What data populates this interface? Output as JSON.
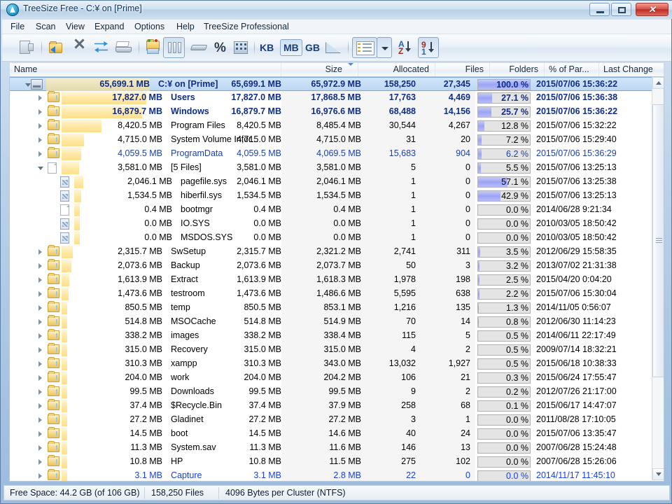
{
  "window": {
    "title": "TreeSize Free - C:¥  on  [Prime]",
    "icon": "treesize-app-icon",
    "minimize_label": "–",
    "maximize_label": "□",
    "close_label": "✕"
  },
  "menu": [
    {
      "label": "File",
      "accel": "F"
    },
    {
      "label": "Scan",
      "accel": "S"
    },
    {
      "label": "View",
      "accel": "V"
    },
    {
      "label": "Expand",
      "accel": "E"
    },
    {
      "label": "Options",
      "accel": "O"
    },
    {
      "label": "Help",
      "accel": "H"
    },
    {
      "label": "TreeSize Professional",
      "accel": ""
    }
  ],
  "toolbar": {
    "icons": [
      {
        "name": "open-drive-icon"
      },
      {
        "name": "open-folder-icon"
      },
      {
        "name": "close-icon"
      },
      {
        "name": "refresh-icon"
      },
      {
        "name": "print-icon"
      },
      {
        "name": "explorer-icon"
      },
      {
        "name": "columns-view-icon"
      },
      {
        "name": "allocated-space-icon"
      },
      {
        "name": "percent-icon"
      },
      {
        "name": "details-view-icon"
      },
      {
        "name": "chart-icon"
      },
      {
        "name": "list-view-icon"
      },
      {
        "name": "dropdown-icon"
      },
      {
        "name": "sort-az-icon"
      },
      {
        "name": "sort-91-icon"
      }
    ],
    "unit_kb": "KB",
    "unit_mb": "MB",
    "unit_gb": "GB",
    "unit_selected": "MB",
    "sort_az_label": "A\nZ",
    "sort_91_label": "9\n1"
  },
  "columns": [
    {
      "key": "name",
      "label": "Name",
      "align": "left"
    },
    {
      "key": "size",
      "label": "Size",
      "align": "right",
      "sorted": true,
      "sort_dir": "desc"
    },
    {
      "key": "allocated",
      "label": "Allocated",
      "align": "right"
    },
    {
      "key": "files",
      "label": "Files",
      "align": "right"
    },
    {
      "key": "folders",
      "label": "Folders",
      "align": "right"
    },
    {
      "key": "percent",
      "label": "% of Par...",
      "align": "right"
    },
    {
      "key": "last_change",
      "label": "Last Change",
      "align": "left"
    }
  ],
  "rows": [
    {
      "indent": 0,
      "icon": "drive",
      "twisty": "open",
      "name": "C:¥  on  [Prime]",
      "size": "65,699.1 MB",
      "bar": 100,
      "allocated": "65,972.9 MB",
      "files": "158,250",
      "folders": "27,345",
      "percent": "100.0 %",
      "pct": 100,
      "last_change": "2015/07/06 15:36:22",
      "style": "navy",
      "selected": true
    },
    {
      "indent": 1,
      "icon": "folder",
      "twisty": "closed",
      "name": "Users",
      "size": "17,827.0 MB",
      "bar": 27.1,
      "allocated": "17,868.5 MB",
      "files": "17,763",
      "folders": "4,469",
      "percent": "27.1 %",
      "pct": 27.1,
      "last_change": "2015/07/06 15:36:38",
      "style": "navy",
      "selected": false
    },
    {
      "indent": 1,
      "icon": "folder",
      "twisty": "closed",
      "name": "Windows",
      "size": "16,879.7 MB",
      "bar": 25.7,
      "allocated": "16,976.6 MB",
      "files": "68,488",
      "folders": "14,156",
      "percent": "25.7 %",
      "pct": 25.7,
      "last_change": "2015/07/06 15:36:22",
      "style": "navy",
      "selected": false
    },
    {
      "indent": 1,
      "icon": "folder",
      "twisty": "closed",
      "name": "Program Files",
      "size": "8,420.5 MB",
      "bar": 12.8,
      "allocated": "8,485.4 MB",
      "files": "30,544",
      "folders": "4,267",
      "percent": "12.8 %",
      "pct": 12.8,
      "last_change": "2015/07/06 15:32:22",
      "style": "black",
      "selected": false
    },
    {
      "indent": 1,
      "icon": "folder",
      "twisty": "closed",
      "name": "System Volume Infor...",
      "size": "4,715.0 MB",
      "bar": 7.2,
      "allocated": "4,715.0 MB",
      "files": "31",
      "folders": "20",
      "percent": "7.2 %",
      "pct": 7.2,
      "last_change": "2015/07/06 15:29:40",
      "style": "black",
      "selected": false
    },
    {
      "indent": 1,
      "icon": "folder",
      "twisty": "closed",
      "name": "ProgramData",
      "size": "4,059.5 MB",
      "bar": 6.2,
      "allocated": "4,069.5 MB",
      "files": "15,683",
      "folders": "904",
      "percent": "6.2 %",
      "pct": 6.2,
      "last_change": "2015/07/06 15:36:29",
      "style": "blue",
      "selected": false
    },
    {
      "indent": 1,
      "icon": "file",
      "twisty": "open",
      "name": "[5 Files]",
      "size": "3,581.0 MB",
      "bar": 5.5,
      "allocated": "3,581.0 MB",
      "files": "5",
      "folders": "0",
      "percent": "5.5 %",
      "pct": 5.5,
      "last_change": "2015/07/06 13:25:13",
      "style": "black",
      "selected": false
    },
    {
      "indent": 2,
      "icon": "sysfile",
      "twisty": "none",
      "name": "pagefile.sys",
      "size": "2,046.1 MB",
      "bar": 3.1,
      "allocated": "2,046.1 MB",
      "files": "1",
      "folders": "0",
      "percent": "57.1 %",
      "pct": 57.1,
      "last_change": "2015/07/06 13:25:38",
      "style": "black",
      "selected": false
    },
    {
      "indent": 2,
      "icon": "sysfile",
      "twisty": "none",
      "name": "hiberfil.sys",
      "size": "1,534.5 MB",
      "bar": 2.3,
      "allocated": "1,534.5 MB",
      "files": "1",
      "folders": "0",
      "percent": "42.9 %",
      "pct": 42.9,
      "last_change": "2015/07/06 13:25:13",
      "style": "black",
      "selected": false
    },
    {
      "indent": 2,
      "icon": "file",
      "twisty": "none",
      "name": "bootmgr",
      "size": "0.4 MB",
      "bar": 0,
      "allocated": "0.4 MB",
      "files": "1",
      "folders": "0",
      "percent": "0.0 %",
      "pct": 0,
      "last_change": "2014/06/28 9:21:34",
      "style": "black",
      "selected": false
    },
    {
      "indent": 2,
      "icon": "sysfile",
      "twisty": "none",
      "name": "IO.SYS",
      "size": "0.0 MB",
      "bar": 0,
      "allocated": "0.0 MB",
      "files": "1",
      "folders": "0",
      "percent": "0.0 %",
      "pct": 0,
      "last_change": "2010/03/05 18:50:42",
      "style": "black",
      "selected": false
    },
    {
      "indent": 2,
      "icon": "sysfile",
      "twisty": "none",
      "name": "MSDOS.SYS",
      "size": "0.0 MB",
      "bar": 0,
      "allocated": "0.0 MB",
      "files": "1",
      "folders": "0",
      "percent": "0.0 %",
      "pct": 0,
      "last_change": "2010/03/05 18:50:42",
      "style": "black",
      "selected": false
    },
    {
      "indent": 1,
      "icon": "folder",
      "twisty": "closed",
      "name": "SwSetup",
      "size": "2,315.7 MB",
      "bar": 3.5,
      "allocated": "2,321.2 MB",
      "files": "2,741",
      "folders": "311",
      "percent": "3.5 %",
      "pct": 3.5,
      "last_change": "2012/06/29 15:58:35",
      "style": "black",
      "selected": false
    },
    {
      "indent": 1,
      "icon": "folder",
      "twisty": "closed",
      "name": "Backup",
      "size": "2,073.6 MB",
      "bar": 3.2,
      "allocated": "2,073.7 MB",
      "files": "50",
      "folders": "3",
      "percent": "3.2 %",
      "pct": 3.2,
      "last_change": "2013/07/02 21:31:38",
      "style": "black",
      "selected": false
    },
    {
      "indent": 1,
      "icon": "folder",
      "twisty": "closed",
      "name": "Extract",
      "size": "1,613.9 MB",
      "bar": 2.5,
      "allocated": "1,618.3 MB",
      "files": "1,978",
      "folders": "198",
      "percent": "2.5 %",
      "pct": 2.5,
      "last_change": "2015/04/20 0:04:20",
      "style": "black",
      "selected": false
    },
    {
      "indent": 1,
      "icon": "folder",
      "twisty": "closed",
      "name": "testroom",
      "size": "1,473.6 MB",
      "bar": 2.2,
      "allocated": "1,486.6 MB",
      "files": "5,595",
      "folders": "638",
      "percent": "2.2 %",
      "pct": 2.2,
      "last_change": "2015/07/06 15:30:04",
      "style": "black",
      "selected": false
    },
    {
      "indent": 1,
      "icon": "folder",
      "twisty": "closed",
      "name": "temp",
      "size": "850.5 MB",
      "bar": 1.3,
      "allocated": "853.1 MB",
      "files": "1,216",
      "folders": "135",
      "percent": "1.3 %",
      "pct": 1.3,
      "last_change": "2014/11/05 0:56:07",
      "style": "black",
      "selected": false
    },
    {
      "indent": 1,
      "icon": "folder",
      "twisty": "closed",
      "name": "MSOCache",
      "size": "514.8 MB",
      "bar": 0.8,
      "allocated": "514.9 MB",
      "files": "70",
      "folders": "14",
      "percent": "0.8 %",
      "pct": 0.8,
      "last_change": "2012/06/30 11:14:23",
      "style": "black",
      "selected": false
    },
    {
      "indent": 1,
      "icon": "folder",
      "twisty": "closed",
      "name": "images",
      "size": "338.2 MB",
      "bar": 0.5,
      "allocated": "338.4 MB",
      "files": "115",
      "folders": "5",
      "percent": "0.5 %",
      "pct": 0.5,
      "last_change": "2014/06/11 22:17:49",
      "style": "black",
      "selected": false
    },
    {
      "indent": 1,
      "icon": "folder",
      "twisty": "closed",
      "name": "Recovery",
      "size": "315.0 MB",
      "bar": 0.5,
      "allocated": "315.0 MB",
      "files": "4",
      "folders": "2",
      "percent": "0.5 %",
      "pct": 0.5,
      "last_change": "2009/07/14 18:32:21",
      "style": "black",
      "selected": false
    },
    {
      "indent": 1,
      "icon": "folder",
      "twisty": "closed",
      "name": "xampp",
      "size": "310.3 MB",
      "bar": 0.5,
      "allocated": "343.0 MB",
      "files": "13,032",
      "folders": "1,927",
      "percent": "0.5 %",
      "pct": 0.5,
      "last_change": "2015/06/18 10:38:33",
      "style": "black",
      "selected": false
    },
    {
      "indent": 1,
      "icon": "folder",
      "twisty": "closed",
      "name": "work",
      "size": "204.0 MB",
      "bar": 0.3,
      "allocated": "204.2 MB",
      "files": "106",
      "folders": "21",
      "percent": "0.3 %",
      "pct": 0.3,
      "last_change": "2015/06/24 17:55:47",
      "style": "black",
      "selected": false
    },
    {
      "indent": 1,
      "icon": "folder",
      "twisty": "closed",
      "name": "Downloads",
      "size": "99.5 MB",
      "bar": 0.2,
      "allocated": "99.5 MB",
      "files": "9",
      "folders": "2",
      "percent": "0.2 %",
      "pct": 0.2,
      "last_change": "2012/07/26 21:17:00",
      "style": "black",
      "selected": false
    },
    {
      "indent": 1,
      "icon": "folder",
      "twisty": "closed",
      "name": "$Recycle.Bin",
      "size": "37.4 MB",
      "bar": 0.1,
      "allocated": "37.9 MB",
      "files": "258",
      "folders": "68",
      "percent": "0.1 %",
      "pct": 0.1,
      "last_change": "2015/06/17 14:47:07",
      "style": "black",
      "selected": false
    },
    {
      "indent": 1,
      "icon": "folder",
      "twisty": "closed",
      "name": "Gladinet",
      "size": "27.2 MB",
      "bar": 0.05,
      "allocated": "27.2 MB",
      "files": "3",
      "folders": "1",
      "percent": "0.0 %",
      "pct": 0,
      "last_change": "2011/08/28 17:10:05",
      "style": "black",
      "selected": false
    },
    {
      "indent": 1,
      "icon": "folder",
      "twisty": "closed",
      "name": "boot",
      "size": "14.5 MB",
      "bar": 0.03,
      "allocated": "14.6 MB",
      "files": "40",
      "folders": "24",
      "percent": "0.0 %",
      "pct": 0,
      "last_change": "2015/07/06 13:35:47",
      "style": "black",
      "selected": false
    },
    {
      "indent": 1,
      "icon": "folder",
      "twisty": "closed",
      "name": "System.sav",
      "size": "11.3 MB",
      "bar": 0.02,
      "allocated": "11.6 MB",
      "files": "146",
      "folders": "13",
      "percent": "0.0 %",
      "pct": 0,
      "last_change": "2007/06/28 15:24:48",
      "style": "black",
      "selected": false
    },
    {
      "indent": 1,
      "icon": "folder",
      "twisty": "closed",
      "name": "HP",
      "size": "10.8 MB",
      "bar": 0.02,
      "allocated": "11.5 MB",
      "files": "275",
      "folders": "102",
      "percent": "0.0 %",
      "pct": 0,
      "last_change": "2007/06/28 15:26:06",
      "style": "black",
      "selected": false
    },
    {
      "indent": 1,
      "icon": "folder",
      "twisty": "closed",
      "name": "Capture",
      "size": "3.1 MB",
      "bar": 0.01,
      "allocated": "2.8 MB",
      "files": "22",
      "folders": "0",
      "percent": "0.0 %",
      "pct": 0,
      "last_change": "2014/11/17 11:45:10",
      "style": "link",
      "selected": false
    }
  ],
  "statusbar": {
    "free_space": "Free Space: 44.2 GB  (of 106 GB)",
    "files": "158,250  Files",
    "cluster": "4096 Bytes per Cluster (NTFS)"
  },
  "scrollbar": {
    "up_icon": "scroll-up-arrow-icon",
    "down_icon": "scroll-down-arrow-icon",
    "thumb_top_pct": 4,
    "thumb_height_pct": 72
  },
  "colors": {
    "navy": "#0f2d86",
    "blue": "#1d3fa8",
    "link": "#1a40e0",
    "bar_fill": "#ffdf8a",
    "pct_fill": "#9aa4f4",
    "selection": "#bcd8f3"
  }
}
